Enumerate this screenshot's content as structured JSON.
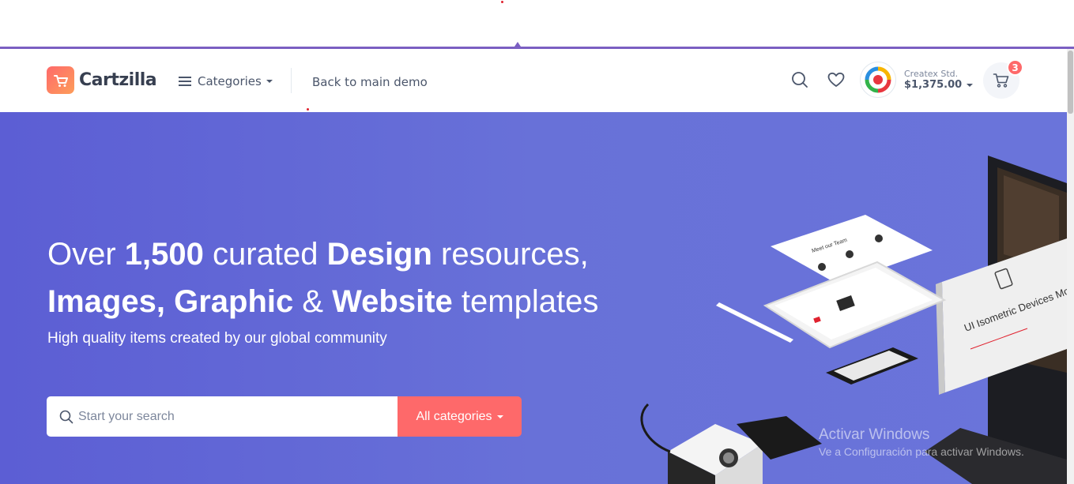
{
  "brand": {
    "name": "Cartzilla"
  },
  "nav": {
    "categories_label": "Categories",
    "back_label": "Back to main demo"
  },
  "account": {
    "name": "Createx Std.",
    "balance": "$1,375.00"
  },
  "cart": {
    "count": "3"
  },
  "hero": {
    "line1_a": "Over ",
    "line1_b": "1,500",
    "line1_c": " curated ",
    "line1_d": "Design",
    "line1_e": " resources,",
    "line2_a": "Images, Graphic",
    "line2_b": " & ",
    "line2_c": "Website",
    "line2_d": " templates",
    "subtitle": "High quality items created by our global community"
  },
  "search": {
    "placeholder": "Start your search",
    "category_button": "All categories"
  },
  "mockup": {
    "sheet_title": "Meet our Team",
    "pack_title": "UI Isometric Devices Mockup Pack"
  },
  "watermark": {
    "line1": "Activar Windows",
    "line2": "Ve a Configuración para activar Windows."
  },
  "colors": {
    "accent": "#fe696a",
    "hero": "#6470d8",
    "topborder": "#7b5fc2"
  }
}
